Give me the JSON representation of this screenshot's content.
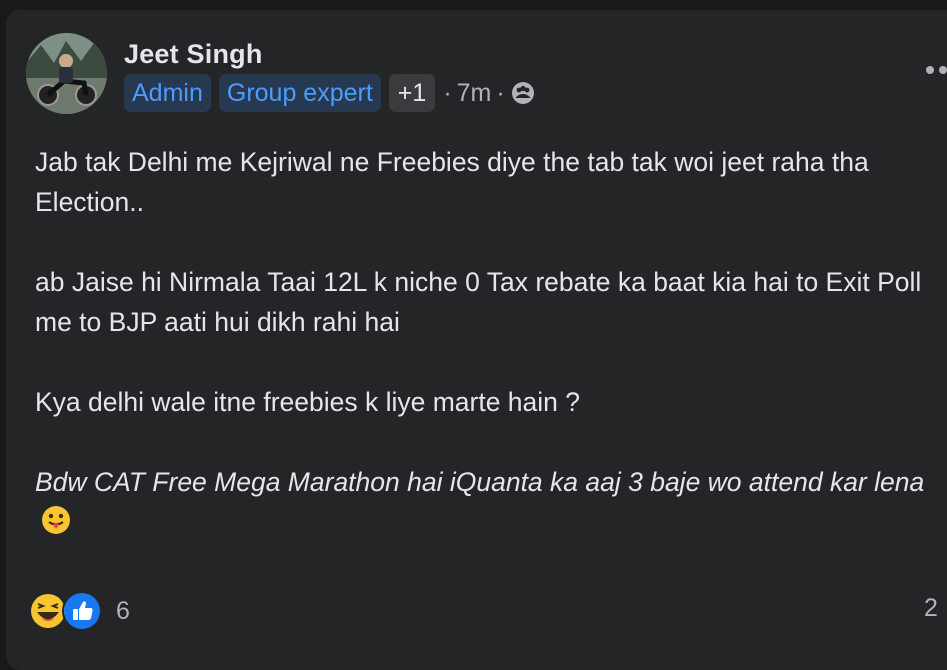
{
  "post": {
    "author": "Jeet Singh",
    "badges": [
      "Admin",
      "Group expert"
    ],
    "more_badges": "+1",
    "separator": "·",
    "time": "7m",
    "audience_icon": "group-icon",
    "paragraphs": [
      "Jab tak Delhi me Kejriwal ne Freebies diye the tab tak woi jeet raha tha Election..",
      "ab Jaise hi Nirmala Taai 12L k niche 0 Tax rebate ka baat kia hai to Exit Poll me to BJP aati hui dikh rahi hai",
      "Kya delhi wale itne freebies k liye marte hain ?"
    ],
    "italic_paragraph": "Bdw CAT Free Mega Marathon hai iQuanta ka aaj 3 baje wo attend kar lena",
    "italic_emoji": "tongue-out-emoji",
    "reactions": {
      "icons": [
        "haha-reaction-icon",
        "like-reaction-icon"
      ],
      "count": "6"
    },
    "comment_count": "2"
  },
  "colors": {
    "background": "#18191a",
    "card": "#242526",
    "primary_text": "#e4e6eb",
    "secondary_text": "#b0b3b8",
    "badge_bg": "#263950",
    "badge_text": "#4a9dff",
    "like_blue": "#1877f2"
  }
}
